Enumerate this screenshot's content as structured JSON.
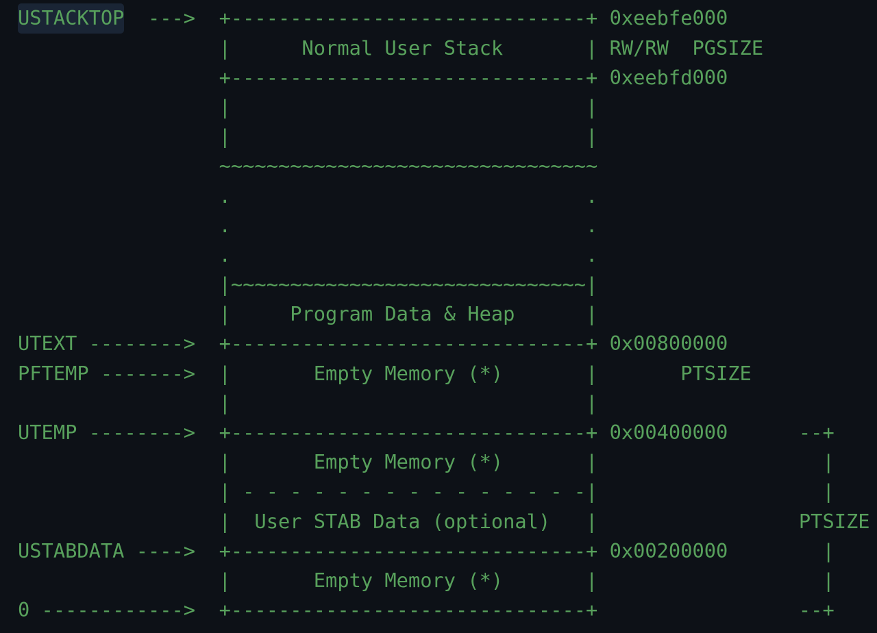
{
  "highlight": "USTACKTOP",
  "lines": [
    "                 |                              |",
    "USTACKTOP  --->  +------------------------------+ 0xeebfe000",
    "                 |      Normal User Stack       | RW/RW  PGSIZE",
    "                 +------------------------------+ 0xeebfd000",
    "                 |                              |",
    "                 |                              |",
    "                 ~~~~~~~~~~~~~~~~~~~~~~~~~~~~~~~~",
    "                 .                              .",
    "                 .                              .",
    "                 .                              .",
    "                 |~~~~~~~~~~~~~~~~~~~~~~~~~~~~~~|",
    "                 |     Program Data & Heap      |",
    "UTEXT -------->  +------------------------------+ 0x00800000",
    "PFTEMP ------->  |       Empty Memory (*)       |       PTSIZE",
    "                 |                              |",
    "UTEMP -------->  +------------------------------+ 0x00400000      --+",
    "                 |       Empty Memory (*)       |                   |",
    "                 | - - - - - - - - - - - - - - -|                   |",
    "                 |  User STAB Data (optional)   |                 PTSIZE",
    "USTABDATA ---->  +------------------------------+ 0x00200000        |",
    "                 |       Empty Memory (*)       |                   |",
    "0 ------------>  +------------------------------+                 --+"
  ]
}
